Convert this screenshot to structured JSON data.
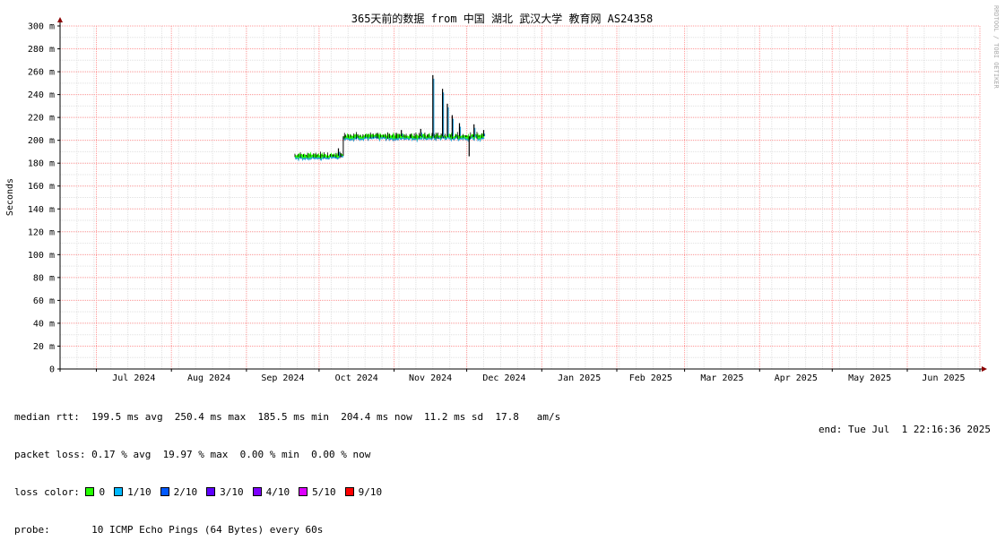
{
  "chart_data": {
    "type": "line",
    "title": "365天前的数据 from 中国 湖北 武汉大学 教育网 AS24358",
    "ylabel": "Seconds",
    "xlabel": "",
    "watermark": "RRDTOOL / TOBI OETIKER",
    "ylim": [
      0,
      0.3
    ],
    "ytick_values": [
      0,
      0.02,
      0.04,
      0.06,
      0.08,
      0.1,
      0.12,
      0.14,
      0.16,
      0.18,
      0.2,
      0.22,
      0.24,
      0.26,
      0.28,
      0.3
    ],
    "ytick_labels": [
      "0",
      "20 m",
      "40 m",
      "60 m",
      "80 m",
      "100 m",
      "120 m",
      "140 m",
      "160 m",
      "180 m",
      "200 m",
      "220 m",
      "240 m",
      "260 m",
      "280 m",
      "300 m"
    ],
    "x_range": [
      "2024-06-16",
      "2025-07-01"
    ],
    "month_starts": [
      "2024-07-01",
      "2024-08-01",
      "2024-09-01",
      "2024-10-01",
      "2024-11-01",
      "2024-12-01",
      "2025-01-01",
      "2025-02-01",
      "2025-03-01",
      "2025-04-01",
      "2025-05-01",
      "2025-06-01",
      "2025-07-01"
    ],
    "month_labels": [
      "Jul 2024",
      "Aug 2024",
      "Sep 2024",
      "Oct 2024",
      "Nov 2024",
      "Dec 2024",
      "Jan 2025",
      "Feb 2025",
      "Mar 2025",
      "Apr 2025",
      "May 2025",
      "Jun 2025"
    ],
    "grid": true,
    "median_rtt_segments": [
      {
        "start": "2024-09-21",
        "end": "2024-10-11",
        "value": 0.1865
      },
      {
        "start": "2024-10-11",
        "end": "2024-12-08",
        "value": 0.2035
      }
    ],
    "rtt_spikes": [
      {
        "x": "2024-10-09",
        "value": 0.193
      },
      {
        "x": "2024-11-04",
        "value": 0.209
      },
      {
        "x": "2024-11-12",
        "value": 0.21
      },
      {
        "x": "2024-11-17",
        "value": 0.257
      },
      {
        "x": "2024-11-21",
        "value": 0.245
      },
      {
        "x": "2024-11-23",
        "value": 0.232
      },
      {
        "x": "2024-11-25",
        "value": 0.222
      },
      {
        "x": "2024-11-28",
        "value": 0.215
      },
      {
        "x": "2024-12-04",
        "value": 0.214
      },
      {
        "x": "2024-12-08",
        "value": 0.209
      }
    ],
    "rtt_dips": [
      {
        "x": "2024-12-02",
        "value": 0.186
      }
    ],
    "colors": {
      "median": "#000000",
      "smoke": "#1e9bd7",
      "loss0": "#26ff00",
      "grid_minor": "#e0e0e0",
      "grid_major": "#ff9999",
      "axis": "#000000",
      "arrow": "#8b0000"
    }
  },
  "stats": {
    "median_rtt": "median rtt:  199.5 ms avg  250.4 ms max  185.5 ms min  204.4 ms now  11.2 ms sd  17.8   am/s",
    "packet_loss": "packet loss: 0.17 % avg  19.97 % max  0.00 % min  0.00 % now",
    "loss_color_label": "loss color:",
    "loss_colors": [
      {
        "label": "0",
        "color": "#26ff00"
      },
      {
        "label": "1/10",
        "color": "#00b8ff"
      },
      {
        "label": "2/10",
        "color": "#0059ff"
      },
      {
        "label": "3/10",
        "color": "#5e00ff"
      },
      {
        "label": "4/10",
        "color": "#7e00ff"
      },
      {
        "label": "5/10",
        "color": "#dd00ff"
      },
      {
        "label": "9/10",
        "color": "#ff0000"
      }
    ],
    "probe": "probe:       10 ICMP Echo Pings (64 Bytes) every 60s",
    "end": "end: Tue Jul  1 22:16:36 2025"
  }
}
